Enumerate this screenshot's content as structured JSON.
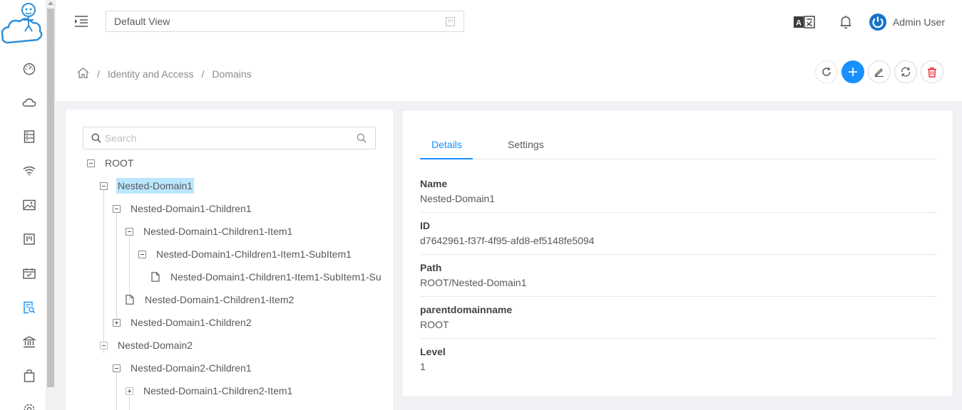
{
  "header": {
    "view_select": "Default View",
    "user_name": "Admin User"
  },
  "sidebar": {
    "icons": [
      "dashboard-icon",
      "cloud-icon",
      "server-icon",
      "wifi-icon",
      "image-icon",
      "board-icon",
      "calendar-check-icon",
      "document-search-icon",
      "bank-icon",
      "bag-icon",
      "settings-icon"
    ],
    "active_icon": "document-search-icon"
  },
  "breadcrumb": {
    "items": [
      "Identity and Access",
      "Domains"
    ],
    "separator": "/"
  },
  "tree": {
    "search_placeholder": "Search",
    "nodes": [
      {
        "title": "ROOT"
      },
      {
        "title": "Nested-Domain1"
      },
      {
        "title": "Nested-Domain1-Children1"
      },
      {
        "title": "Nested-Domain1-Children1-Item1"
      },
      {
        "title": "Nested-Domain1-Children1-Item1-SubItem1"
      },
      {
        "title": "Nested-Domain1-Children1-Item1-SubItem1-Su"
      },
      {
        "title": "Nested-Domain1-Children1-Item2"
      },
      {
        "title": "Nested-Domain1-Children2"
      },
      {
        "title": "Nested-Domain2"
      },
      {
        "title": "Nested-Domain2-Children1"
      },
      {
        "title": "Nested-Domain1-Children2-Item1"
      }
    ]
  },
  "details": {
    "tabs": [
      "Details",
      "Settings"
    ],
    "fields": [
      {
        "label": "Name",
        "value": "Nested-Domain1"
      },
      {
        "label": "ID",
        "value": "d7642961-f37f-4f95-afd8-ef5148fe5094"
      },
      {
        "label": "Path",
        "value": "ROOT/Nested-Domain1"
      },
      {
        "label": "parentdomainname",
        "value": "ROOT"
      },
      {
        "label": "Level",
        "value": "1"
      }
    ]
  },
  "colors": {
    "primary": "#1890ff",
    "selected_bg": "#bae7ff",
    "danger": "#f5222d"
  }
}
